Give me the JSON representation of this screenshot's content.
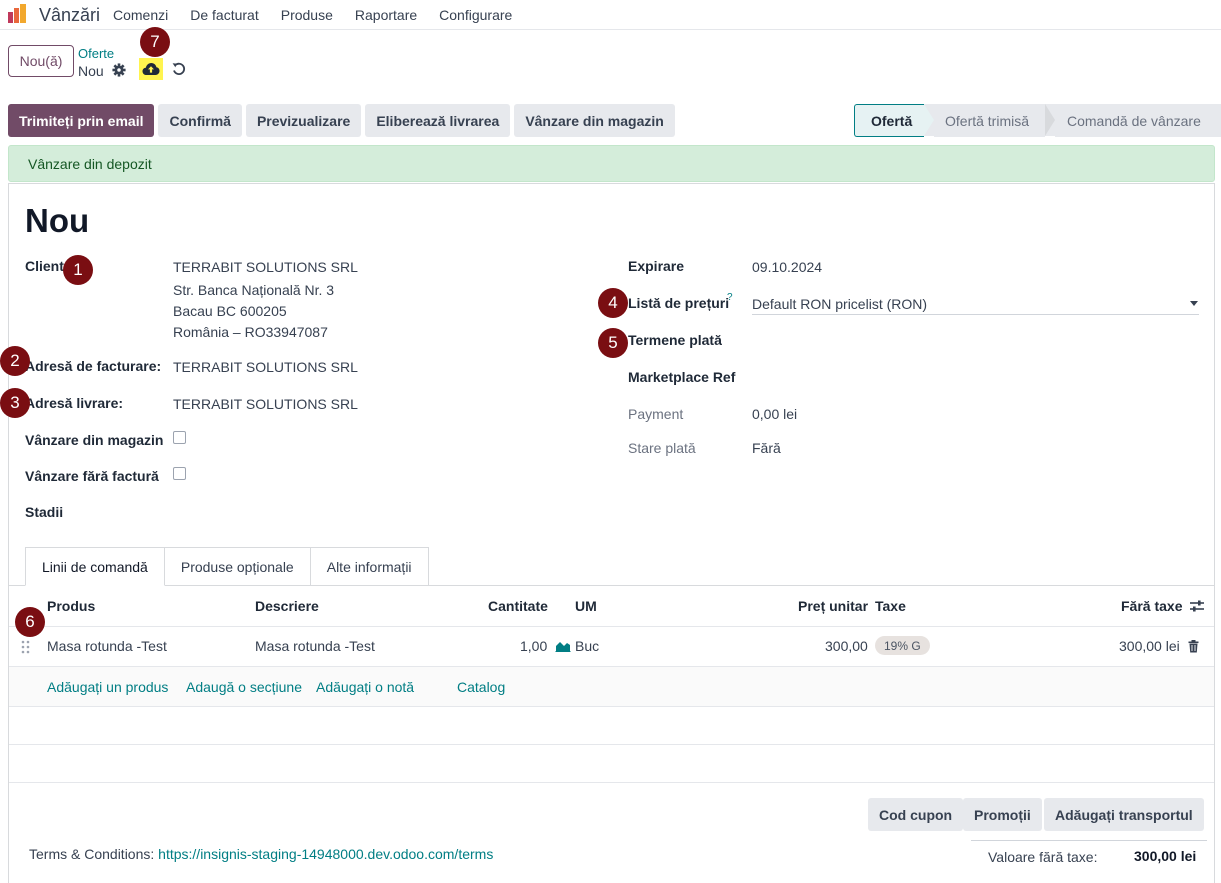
{
  "app": {
    "name": "Vânzări",
    "menu": [
      "Comenzi",
      "De facturat",
      "Produse",
      "Raportare",
      "Configurare"
    ]
  },
  "control": {
    "new_button": "Nou(ă)",
    "breadcrumb_parent": "Oferte",
    "breadcrumb_current": "Nou"
  },
  "actions": [
    "Trimiteți prin email",
    "Confirmă",
    "Previzualizare",
    "Eliberează livrarea",
    "Vânzare din magazin"
  ],
  "stages": [
    "Ofertă",
    "Ofertă trimisă",
    "Comandă de vânzare"
  ],
  "active_stage": "Ofertă",
  "banner": "Vânzare din depozit",
  "record": {
    "title": "Nou",
    "client_label": "Client",
    "client_lines": [
      "TERRABIT SOLUTIONS SRL",
      "Str. Banca Națională Nr. 3",
      "Bacau BC 600205",
      "România – RO33947087"
    ],
    "invoice_address_label": "Adresă de facturare:",
    "invoice_address": "TERRABIT SOLUTIONS SRL",
    "delivery_address_label": "Adresă livrare:",
    "delivery_address": "TERRABIT SOLUTIONS SRL",
    "store_sale_label": "Vânzare din magazin",
    "no_invoice_label": "Vânzare fără factură",
    "stages_label": "Stadii",
    "expiry_label": "Expirare",
    "expiry_value": "09.10.2024",
    "pricelist_label": "Listă de prețuri",
    "pricelist_help": "?",
    "pricelist_value": "Default RON pricelist (RON)",
    "payment_terms_label": "Termene plată",
    "marketplace_label": "Marketplace Ref",
    "payment_label": "Payment",
    "payment_value": "0,00 lei",
    "payment_state_label": "Stare plată",
    "payment_state_value": "Fără"
  },
  "markers": [
    "1",
    "2",
    "3",
    "4",
    "5",
    "6",
    "7"
  ],
  "tabs": [
    "Linii de comandă",
    "Produse opționale",
    "Alte informații"
  ],
  "table": {
    "headers": {
      "product": "Produs",
      "description": "Descriere",
      "quantity": "Cantitate",
      "uom": "UM",
      "unit_price": "Preț unitar",
      "taxes": "Taxe",
      "subtotal": "Fără taxe"
    },
    "rows": [
      {
        "product": "Masa rotunda -Test",
        "description": "Masa rotunda -Test",
        "quantity": "1,00",
        "uom": "Buc",
        "unit_price": "300,00",
        "tax": "19% G",
        "subtotal": "300,00 lei"
      }
    ],
    "add_links": [
      "Adăugați un produs",
      "Adaugă o secțiune",
      "Adăugați o notă",
      "Catalog"
    ]
  },
  "footer": {
    "buttons": [
      "Cod cupon",
      "Promoții",
      "Adăugați transportul"
    ],
    "terms_label": "Terms & Conditions:",
    "terms_link": "https://insignis-staging-14948000.dev.odoo.com/terms",
    "untaxed_label": "Valoare fără taxe:",
    "untaxed_value": "300,00 lei"
  },
  "colors": {
    "brand": "#714b67",
    "link": "#017e84",
    "marker": "#7a0e12",
    "highlight": "#fff44f",
    "banner_bg": "#d4edda"
  }
}
